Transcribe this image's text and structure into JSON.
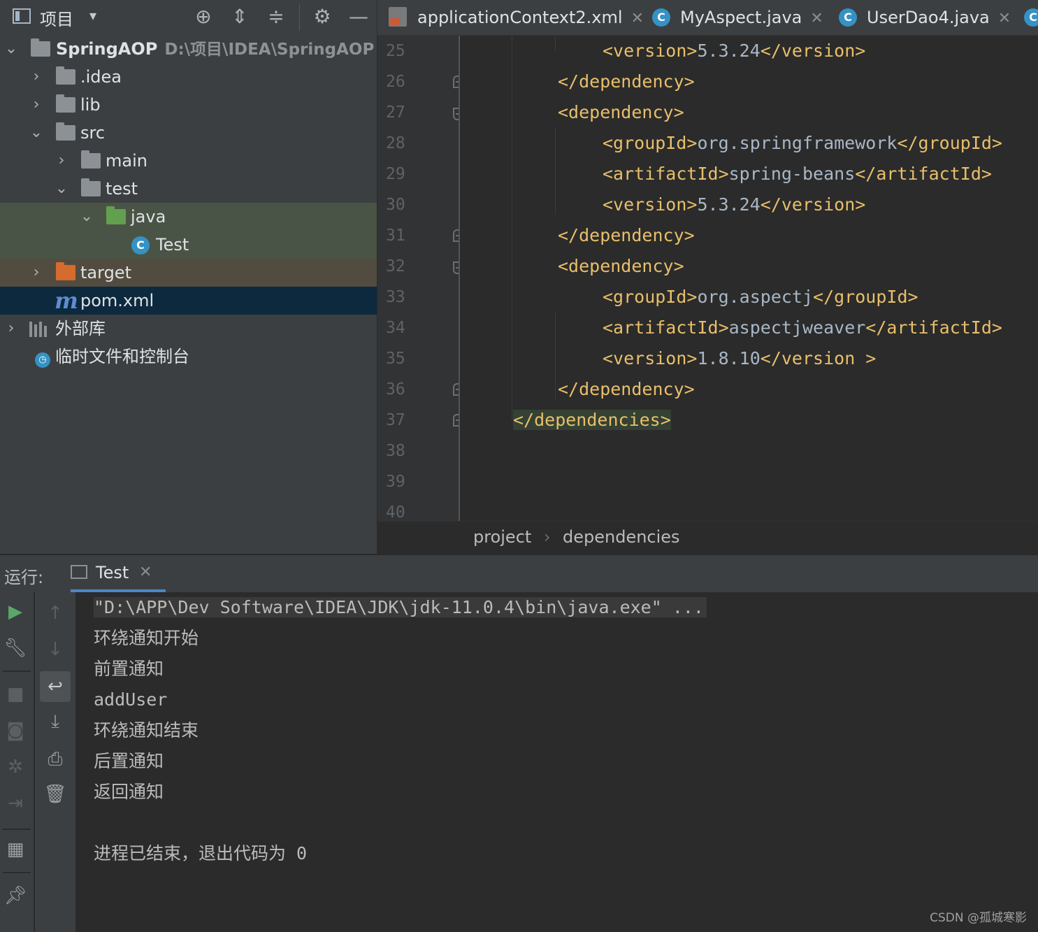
{
  "project_panel": {
    "title": "项目",
    "dropdown": "▾",
    "tree": [
      {
        "label": "SpringAOP",
        "path": "D:\\项目\\IDEA\\SpringAOP"
      },
      {
        "label": ".idea"
      },
      {
        "label": "lib"
      },
      {
        "label": "src"
      },
      {
        "label": "main"
      },
      {
        "label": "test"
      },
      {
        "label": "java"
      },
      {
        "label": "Test"
      },
      {
        "label": "target"
      },
      {
        "label": "pom.xml"
      },
      {
        "label": "外部库"
      },
      {
        "label": "临时文件和控制台"
      }
    ]
  },
  "tabs": [
    {
      "label": "applicationContext2.xml"
    },
    {
      "label": "MyAspect.java"
    },
    {
      "label": "UserDao4.java"
    }
  ],
  "editor": {
    "line_numbers": [
      "25",
      "26",
      "27",
      "28",
      "29",
      "30",
      "31",
      "32",
      "33",
      "34",
      "35",
      "36",
      "37",
      "38",
      "39",
      "40"
    ],
    "lines": [
      {
        "open": "<version>",
        "text": "5.3.24",
        "close": "</version>"
      },
      {
        "open": "</dependency>",
        "text": "",
        "close": ""
      },
      {
        "open": "<dependency>",
        "text": "",
        "close": ""
      },
      {
        "open": "<groupId>",
        "text": "org.springframework",
        "close": "</groupId>"
      },
      {
        "open": "<artifactId>",
        "text": "spring-beans",
        "close": "</artifactId>"
      },
      {
        "open": "<version>",
        "text": "5.3.24",
        "close": "</version>"
      },
      {
        "open": "</dependency>",
        "text": "",
        "close": ""
      },
      {
        "open": "<dependency>",
        "text": "",
        "close": ""
      },
      {
        "open": "<groupId>",
        "text": "org.aspectj",
        "close": "</groupId>"
      },
      {
        "open": "<artifactId>",
        "text": "aspectjweaver",
        "close": "</artifactId>"
      },
      {
        "open": "<version>",
        "text": "1.8.10",
        "close": "</version >"
      },
      {
        "open": "</dependency>",
        "text": "",
        "close": ""
      },
      {
        "open": "</dependencies>",
        "text": "",
        "close": ""
      }
    ],
    "breadcrumb": [
      "project",
      "dependencies"
    ]
  },
  "run": {
    "label": "运行:",
    "tab": "Test",
    "console": [
      "\"D:\\APP\\Dev Software\\IDEA\\JDK\\jdk-11.0.4\\bin\\java.exe\" ...",
      "环绕通知开始",
      "前置通知",
      "addUser",
      "环绕通知结束",
      "后置通知",
      "返回通知",
      "",
      "进程已结束，退出代码为 0"
    ]
  },
  "watermark": "CSDN @孤城寒影",
  "colors": {
    "panel_bg": "#3c3f41",
    "editor_bg": "#2b2b2b",
    "xml_tag": "#e8bf6a",
    "xml_text": "#a9b7c6",
    "selection": "#0d293e",
    "accent": "#4a88c7"
  }
}
